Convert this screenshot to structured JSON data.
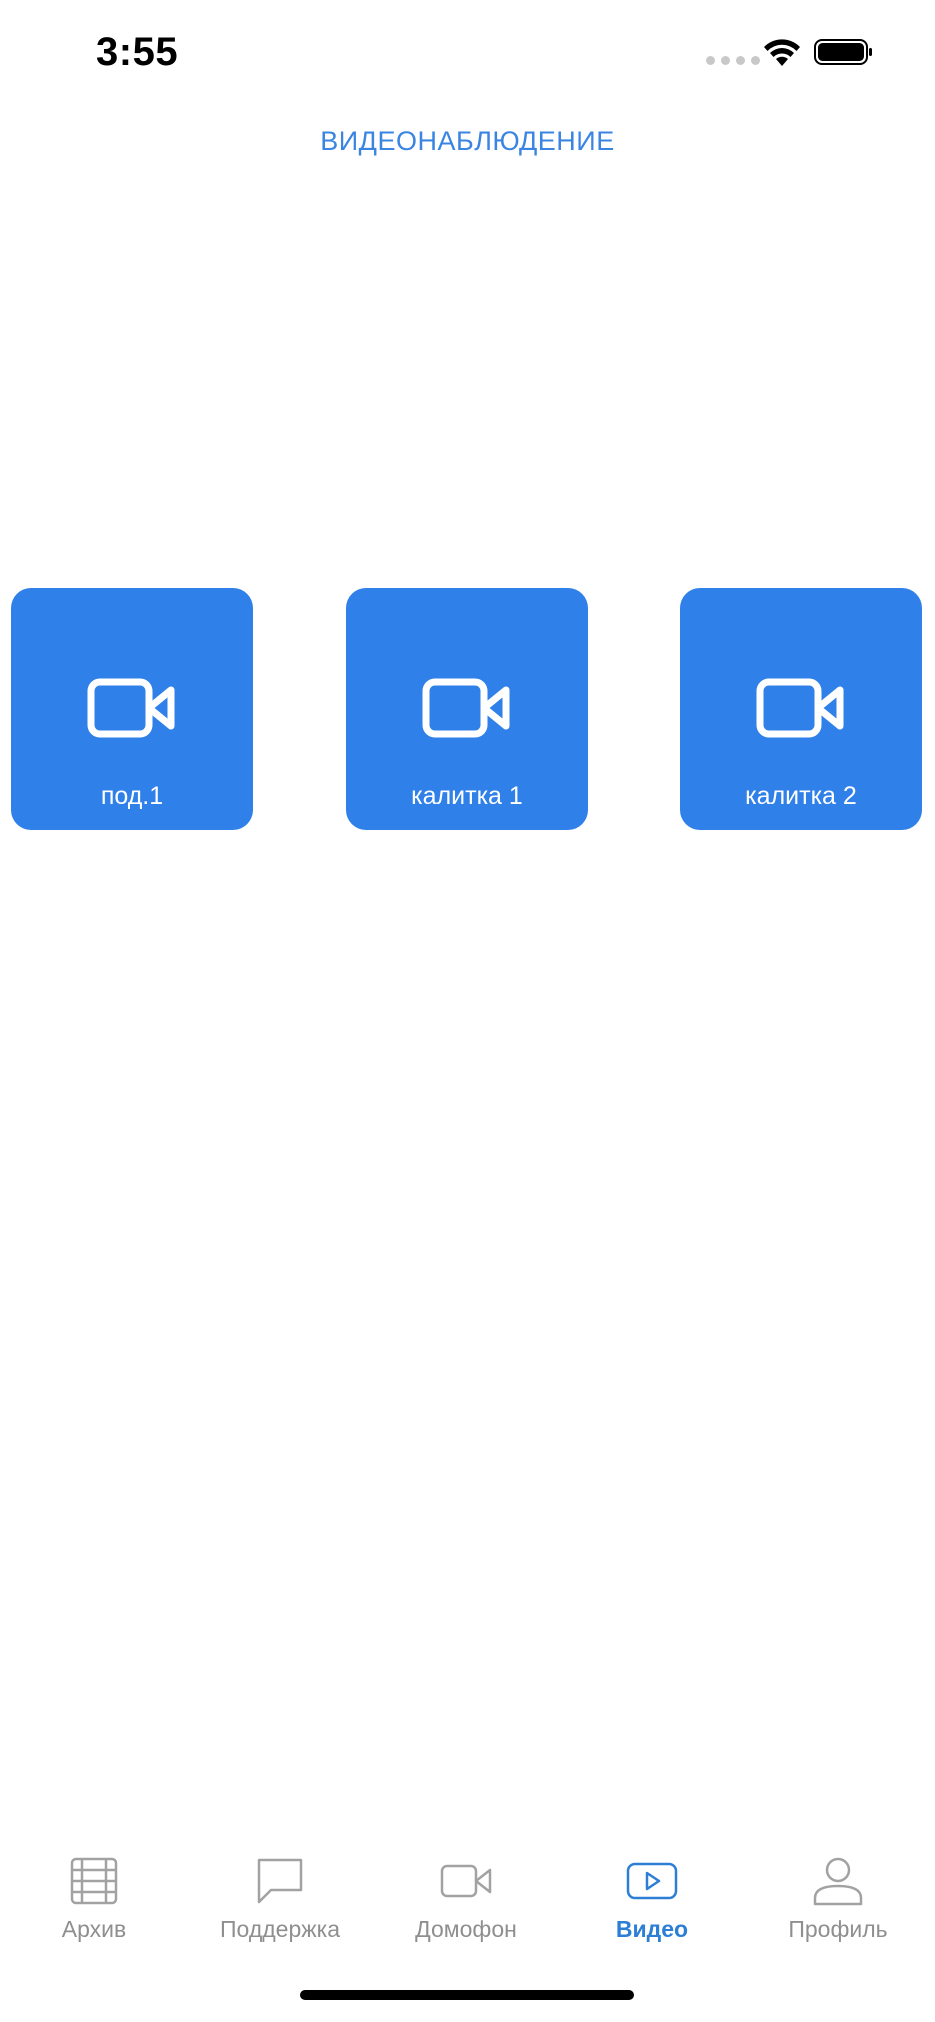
{
  "status_bar": {
    "time": "3:55"
  },
  "header": {
    "title": "ВИДЕОНАБЛЮДЕНИЕ"
  },
  "cameras": [
    {
      "label": "под.1",
      "icon": "video-camera-icon"
    },
    {
      "label": "калитка 1",
      "icon": "video-camera-icon"
    },
    {
      "label": "калитка 2",
      "icon": "video-camera-icon"
    }
  ],
  "tab_bar": {
    "active": "Видео",
    "tabs": [
      {
        "label": "Архив",
        "icon": "film-icon"
      },
      {
        "label": "Поддержка",
        "icon": "chat-bubble-icon"
      },
      {
        "label": "Домофон",
        "icon": "video-camera-icon"
      },
      {
        "label": "Видео",
        "icon": "play-icon"
      },
      {
        "label": "Профиль",
        "icon": "user-icon"
      }
    ]
  },
  "colors": {
    "accent": "#3080ea",
    "title": "#3a85e2",
    "tab_active": "#2d7fd6",
    "tab_inactive": "#8f8f8f"
  }
}
